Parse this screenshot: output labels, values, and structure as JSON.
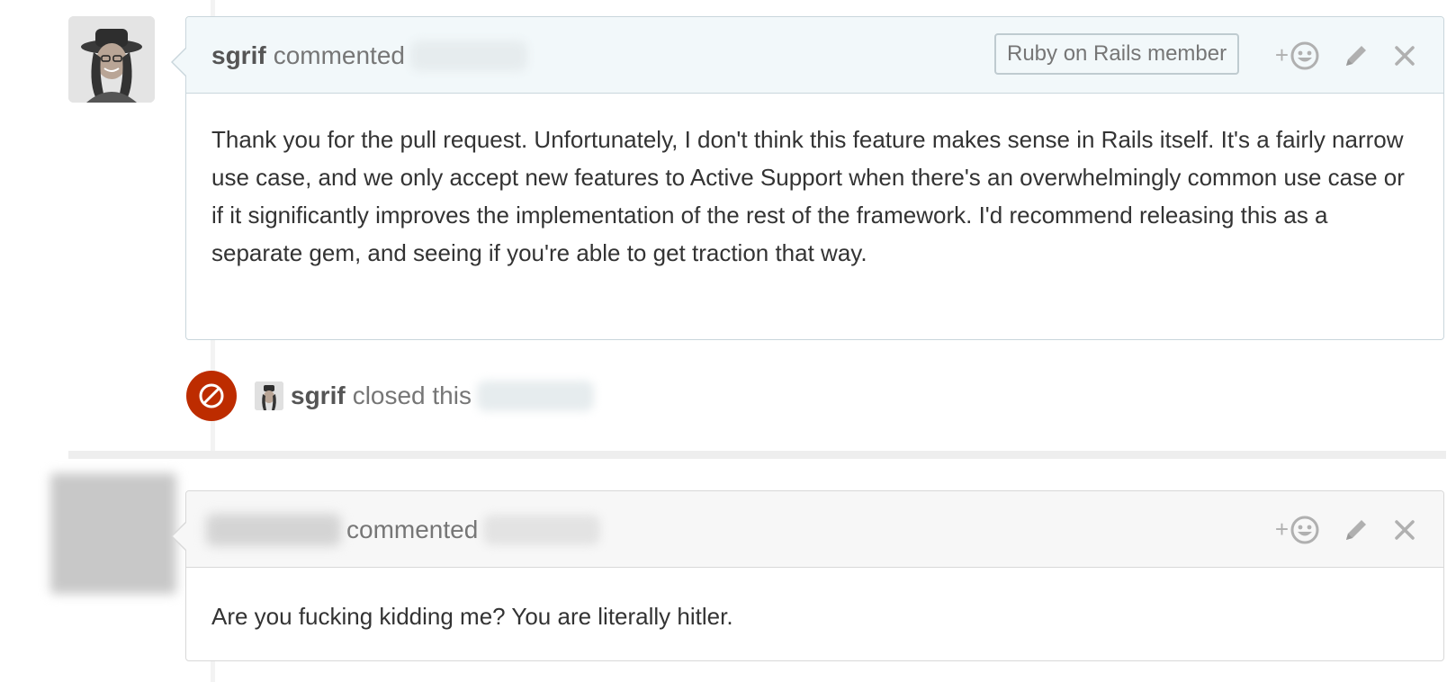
{
  "comments": [
    {
      "author": "sgrif",
      "action": "commented",
      "badge": "Ruby on Rails member",
      "body": "Thank you for the pull request. Unfortunately, I don't think this feature makes sense in Rails itself. It's a fairly narrow use case, and we only accept new features to Active Support when there's an overwhelmingly common use case or if it significantly improves the implementation of the rest of the framework. I'd recommend releasing this as a separate gem, and seeing if you're able to get traction that way."
    },
    {
      "action": "commented",
      "body": "Are you fucking kidding me? You are literally hitler."
    }
  ],
  "event": {
    "author": "sgrif",
    "action": "closed this",
    "badge_color": "#bd2c00"
  },
  "actions": {
    "reaction_plus": "+"
  },
  "icons": [
    "smiley-icon",
    "pencil-icon",
    "close-icon",
    "circle-slash-icon"
  ],
  "colors": {
    "header_bg_member": "#f2f8fa",
    "header_bg_default": "#f7f7f7",
    "closed_badge": "#bd2c00"
  }
}
